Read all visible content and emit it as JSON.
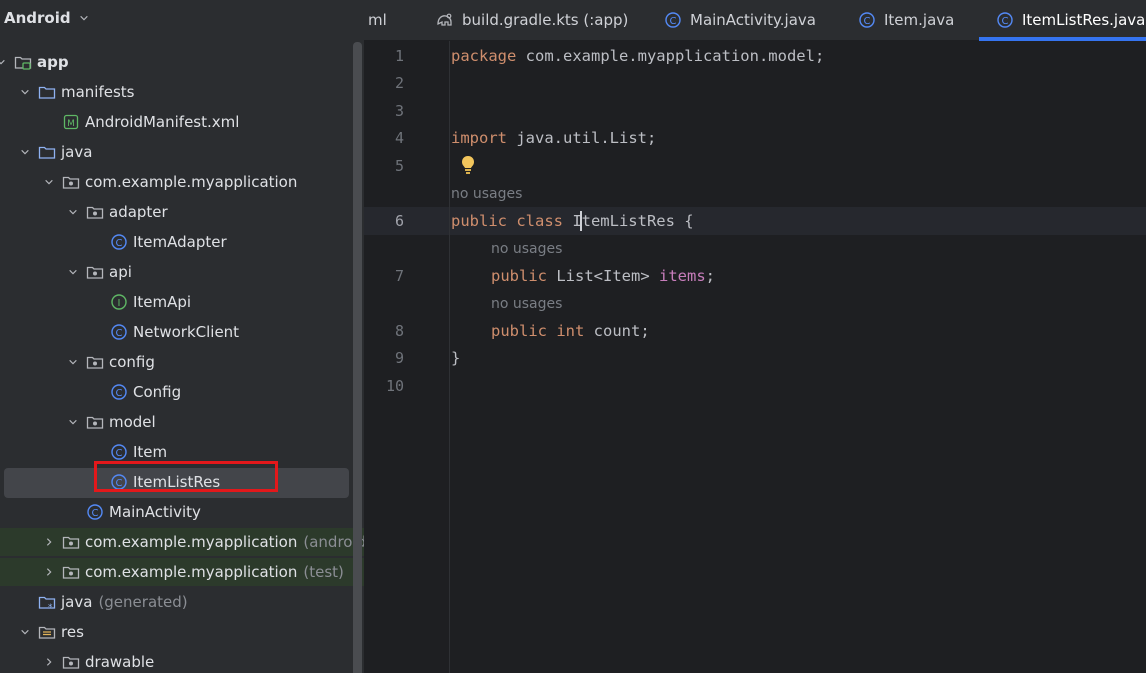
{
  "project_panel": {
    "view_selector": "Android",
    "tree": [
      {
        "label": "app",
        "suffix": "",
        "depth": 0,
        "icon": "module-folder-icon",
        "expanded": true,
        "bold": true
      },
      {
        "label": "manifests",
        "suffix": "",
        "depth": 1,
        "icon": "folder-icon",
        "expanded": true
      },
      {
        "label": "AndroidManifest.xml",
        "suffix": "",
        "depth": 2,
        "icon": "manifest-file-icon"
      },
      {
        "label": "java",
        "suffix": "",
        "depth": 1,
        "icon": "folder-icon",
        "expanded": true
      },
      {
        "label": "com.example.myapplication",
        "suffix": "",
        "depth": 2,
        "icon": "package-icon",
        "expanded": true
      },
      {
        "label": "adapter",
        "suffix": "",
        "depth": 3,
        "icon": "package-icon",
        "expanded": true
      },
      {
        "label": "ItemAdapter",
        "suffix": "",
        "depth": 4,
        "icon": "class-icon"
      },
      {
        "label": "api",
        "suffix": "",
        "depth": 3,
        "icon": "package-icon",
        "expanded": true
      },
      {
        "label": "ItemApi",
        "suffix": "",
        "depth": 4,
        "icon": "interface-icon"
      },
      {
        "label": "NetworkClient",
        "suffix": "",
        "depth": 4,
        "icon": "class-icon"
      },
      {
        "label": "config",
        "suffix": "",
        "depth": 3,
        "icon": "package-icon",
        "expanded": true
      },
      {
        "label": "Config",
        "suffix": "",
        "depth": 4,
        "icon": "class-icon"
      },
      {
        "label": "model",
        "suffix": "",
        "depth": 3,
        "icon": "package-icon",
        "expanded": true
      },
      {
        "label": "Item",
        "suffix": "",
        "depth": 4,
        "icon": "class-icon"
      },
      {
        "label": "ItemListRes",
        "suffix": "",
        "depth": 4,
        "icon": "class-icon",
        "selected": true
      },
      {
        "label": "MainActivity",
        "suffix": "",
        "depth": 3,
        "icon": "class-icon"
      },
      {
        "label": "com.example.myapplication",
        "suffix": "(androidTest)",
        "depth": 2,
        "icon": "package-icon",
        "expanded": false,
        "tinted": true
      },
      {
        "label": "com.example.myapplication",
        "suffix": "(test)",
        "depth": 2,
        "icon": "package-icon",
        "expanded": false,
        "tinted": true
      },
      {
        "label": "java",
        "suffix": "(generated)",
        "depth": 1,
        "icon": "generated-folder-icon"
      },
      {
        "label": "res",
        "suffix": "",
        "depth": 1,
        "icon": "resource-folder-icon",
        "expanded": true
      },
      {
        "label": "drawable",
        "suffix": "",
        "depth": 2,
        "icon": "package-icon",
        "expanded": false
      }
    ]
  },
  "tabs": [
    {
      "label": "ml",
      "icon": "",
      "active": false
    },
    {
      "label": "build.gradle.kts (:app)",
      "icon": "gradle-icon",
      "active": false
    },
    {
      "label": "MainActivity.java",
      "icon": "class-icon",
      "active": false
    },
    {
      "label": "Item.java",
      "icon": "class-icon",
      "active": false
    },
    {
      "label": "ItemListRes.java",
      "icon": "class-icon",
      "active": true
    }
  ],
  "editor": {
    "line_numbers": [
      "1",
      "2",
      "3",
      "4",
      "5",
      "6",
      "7",
      "8",
      "9",
      "10"
    ],
    "current_line": "6",
    "inlay_hint": "no usages",
    "code": {
      "l1_kw": "package",
      "l1_rest": " com.example.myapplication.model;",
      "l4_kw": "import",
      "l4_rest": " java.util.List;",
      "l6_kw": "public class",
      "l6_name": " ItemListRes",
      "l6_rest": " {",
      "l7_kw": "public",
      "l7_type": " List<Item>",
      "l7_field": " items",
      "l7_end": ";",
      "l8_kw": "public int",
      "l8_field": " count",
      "l8_end": ";",
      "l9": "}"
    }
  },
  "colors": {
    "keyword": "#cf8e6d",
    "field": "#c77dbb",
    "plain": "#bcbec4",
    "active_tab_underline": "#3574f0",
    "annotation_box": "#e3181b",
    "class_icon": "#548af7",
    "interface_icon": "#5fb865"
  }
}
